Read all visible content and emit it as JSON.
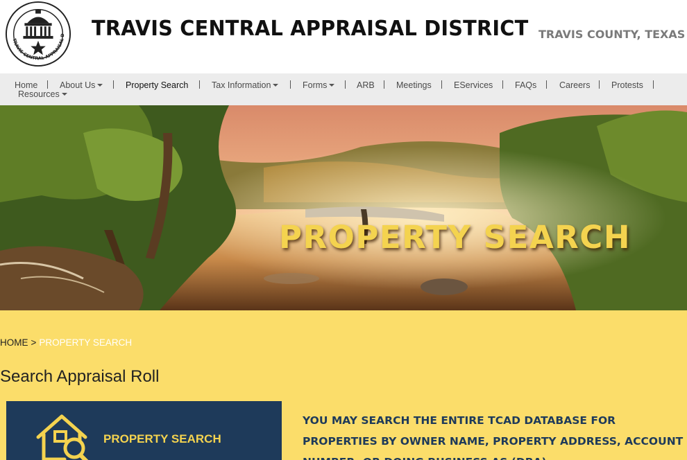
{
  "header": {
    "logo_text": "TRAVIS CENTRAL APPRAISAL DISTRICT",
    "title": "TRAVIS CENTRAL APPRAISAL DISTRICT",
    "subtitle": "TRAVIS COUNTY, TEXAS"
  },
  "nav": {
    "items": [
      {
        "label": "Home",
        "dropdown": false
      },
      {
        "label": "About Us",
        "dropdown": true
      },
      {
        "label": "Property Search",
        "dropdown": false,
        "active": true
      },
      {
        "label": "Tax Information",
        "dropdown": true
      },
      {
        "label": "Forms",
        "dropdown": true
      },
      {
        "label": "ARB",
        "dropdown": false
      },
      {
        "label": "Meetings",
        "dropdown": false
      },
      {
        "label": "EServices",
        "dropdown": false
      },
      {
        "label": "FAQs",
        "dropdown": false
      },
      {
        "label": "Careers",
        "dropdown": false
      },
      {
        "label": "Protests",
        "dropdown": false
      },
      {
        "label": "Resources",
        "dropdown": true
      }
    ]
  },
  "hero": {
    "title": "PROPERTY SEARCH"
  },
  "breadcrumb": {
    "home": "HOME",
    "separator": ">",
    "current": "PROPERTY SEARCH"
  },
  "main": {
    "section_title": "Search Appraisal Roll",
    "card_label": "PROPERTY SEARCH",
    "card_icon": "house-search-icon",
    "description": "YOU MAY SEARCH THE ENTIRE TCAD DATABASE FOR PROPERTIES BY OWNER NAME, PROPERTY ADDRESS, ACCOUNT NUMBER, OR DOING BUSINESS AS (DBA)."
  },
  "colors": {
    "accent_yellow": "#fbdd6a",
    "hero_text": "#f4d34f",
    "navy": "#1e3a5a",
    "nav_bg": "#ececec"
  }
}
